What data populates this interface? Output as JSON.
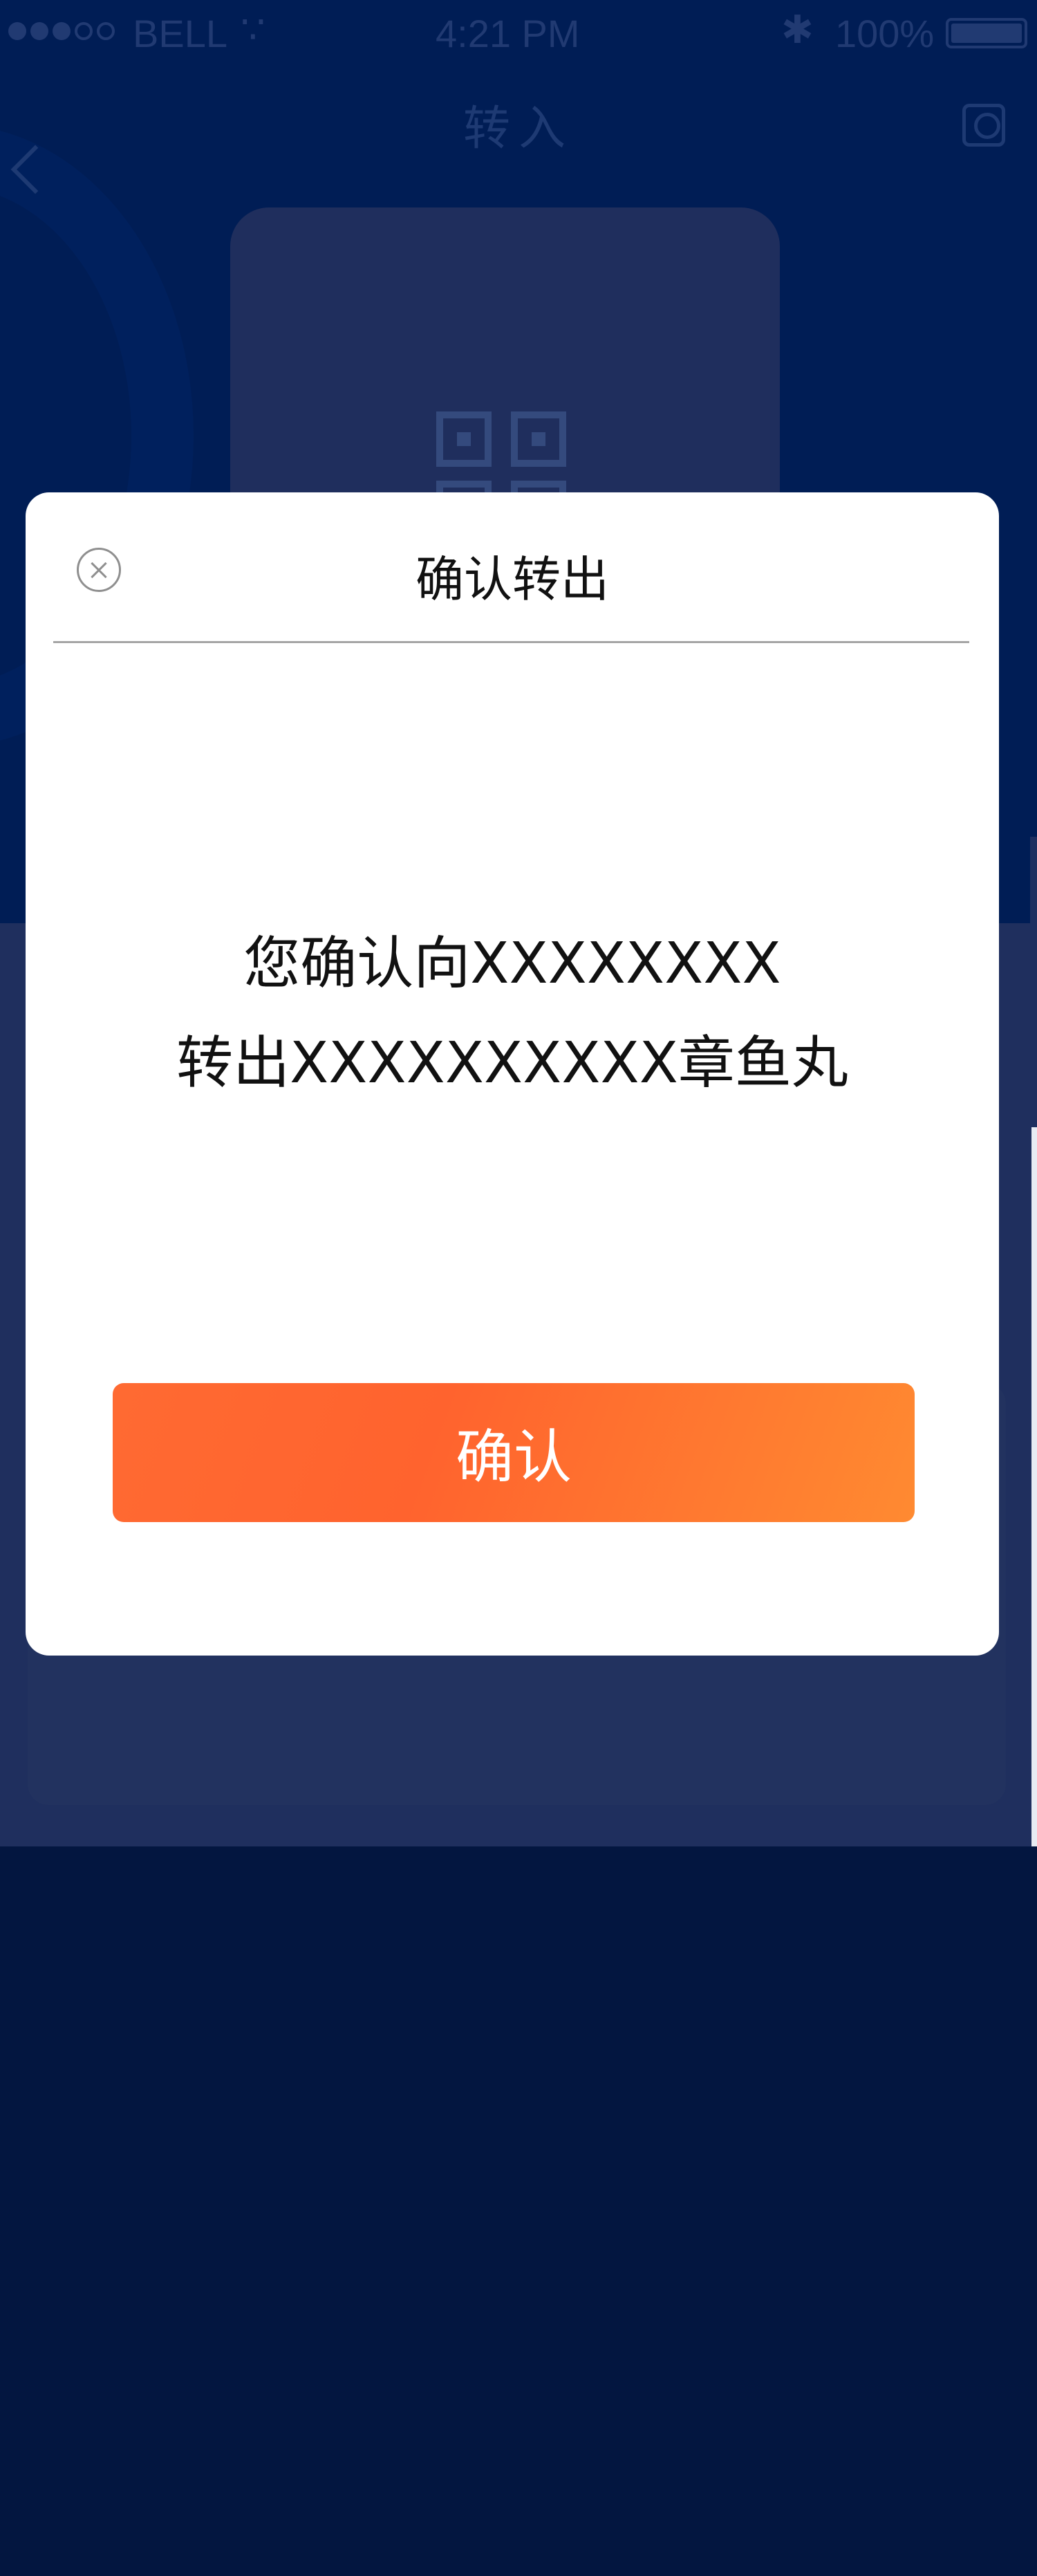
{
  "status_bar": {
    "carrier": "BELL",
    "time": "4:21 PM",
    "battery": "100%"
  },
  "nav": {
    "title": "转入"
  },
  "dialog": {
    "title": "确认转出",
    "message_line1": "您确认向XXXXXXXX",
    "message_line2": "转出XXXXXXXXXX章鱼丸",
    "confirm_label": "确认"
  },
  "icons": [
    "back-icon",
    "history-icon",
    "qr-code-icon",
    "close-icon",
    "wifi-icon",
    "bluetooth-icon",
    "battery-icon"
  ],
  "colors": {
    "overlay_blue": "#001d55",
    "confirm_orange": "#ff6a32",
    "dialog_bg": "#ffffff"
  }
}
